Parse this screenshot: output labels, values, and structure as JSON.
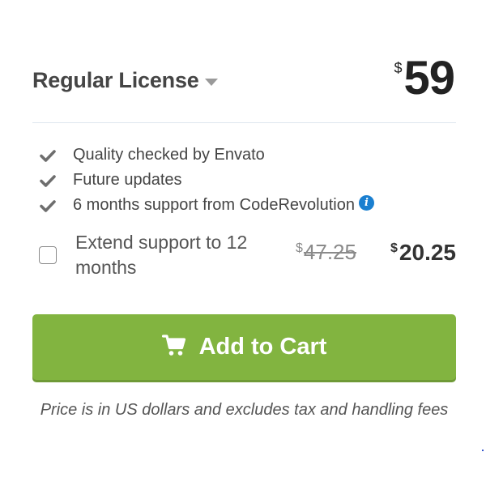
{
  "license": {
    "title": "Regular License",
    "currency_symbol": "$",
    "price": "59"
  },
  "features": [
    {
      "label": "Quality checked by Envato",
      "icon": "check-icon"
    },
    {
      "label": "Future updates",
      "icon": "check-icon"
    },
    {
      "label": "6 months support from CodeRevolution",
      "icon": "check-icon",
      "extra_icon": "info-icon"
    }
  ],
  "info_icon_glyph": "i",
  "extend_support": {
    "label": "Extend support to 12 months",
    "checked": false,
    "old_currency_symbol": "$",
    "old_price": "47.25",
    "new_currency_symbol": "$",
    "new_price": "20.25"
  },
  "cart": {
    "label": "Add to Cart",
    "icon": "cart-icon",
    "color": "#82b440"
  },
  "disclaimer": "Price is in US dollars and excludes tax and handling fees",
  "colors": {
    "accent_green": "#82b440",
    "info_blue": "#1a7fd0",
    "divider": "#dfe7ee"
  }
}
